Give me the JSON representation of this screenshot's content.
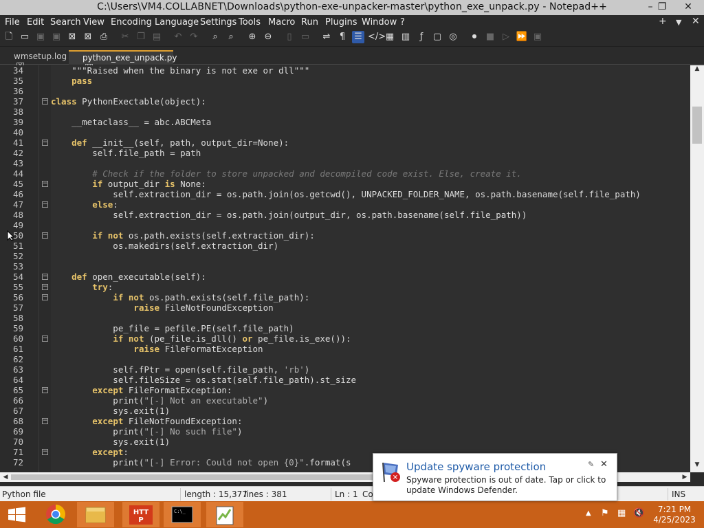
{
  "window": {
    "title": "C:\\Users\\VM4.COLLABNET\\Downloads\\python-exe-unpacker-master\\python_exe_unpack.py - Notepad++",
    "minimize": "–",
    "restore": "❐",
    "close": "✕"
  },
  "menu": {
    "items": [
      "File",
      "Edit",
      "Search",
      "View",
      "Encoding",
      "Language",
      "Settings",
      "Tools",
      "Macro",
      "Run",
      "Plugins",
      "Window",
      "?"
    ],
    "right_plus": "+",
    "right_down": "▼",
    "right_close": "✕"
  },
  "tabs": [
    {
      "label": "wmsetup.log",
      "active": false
    },
    {
      "label": "python_exe_unpack.py",
      "active": true
    }
  ],
  "editor": {
    "line_numbers": [
      "34",
      "35",
      "36",
      "37",
      "38",
      "39",
      "40",
      "41",
      "42",
      "43",
      "44",
      "45",
      "46",
      "47",
      "48",
      "49",
      "50",
      "51",
      "52",
      "53",
      "54",
      "55",
      "56",
      "57",
      "58",
      "59",
      "60",
      "61",
      "62",
      "63",
      "64",
      "65",
      "66",
      "67",
      "68",
      "69",
      "70",
      "71",
      "72"
    ],
    "lines": [
      [
        [
          "",
          "    \"\"\"Raised when the binary is not exe or dll\"\"\""
        ]
      ],
      [
        [
          "",
          "    "
        ],
        [
          "kw",
          "pass"
        ]
      ],
      [
        [
          "",
          ""
        ]
      ],
      [
        [
          "kw",
          "class"
        ],
        [
          "",
          " PythonExectable(object):"
        ]
      ],
      [
        [
          "",
          ""
        ]
      ],
      [
        [
          "",
          "    __metaclass__ = abc.ABCMeta"
        ]
      ],
      [
        [
          "",
          ""
        ]
      ],
      [
        [
          "",
          "    "
        ],
        [
          "kw",
          "def"
        ],
        [
          "",
          " __init__(self, path, output_dir=None):"
        ]
      ],
      [
        [
          "",
          "        self.file_path = path"
        ]
      ],
      [
        [
          "",
          ""
        ]
      ],
      [
        [
          "cm",
          "        # Check if the folder to store unpacked and decompiled code exist. Else, create it."
        ]
      ],
      [
        [
          "",
          "        "
        ],
        [
          "kw",
          "if"
        ],
        [
          "",
          " output_dir "
        ],
        [
          "kw",
          "is"
        ],
        [
          "",
          " None:"
        ]
      ],
      [
        [
          "",
          "            self.extraction_dir = os.path.join(os.getcwd(), UNPACKED_FOLDER_NAME, os.path.basename(self.file_path)"
        ]
      ],
      [
        [
          "",
          "        "
        ],
        [
          "kw",
          "else"
        ],
        [
          "",
          ":"
        ]
      ],
      [
        [
          "",
          "            self.extraction_dir = os.path.join(output_dir, os.path.basename(self.file_path))"
        ]
      ],
      [
        [
          "",
          ""
        ]
      ],
      [
        [
          "",
          "        "
        ],
        [
          "kw",
          "if not"
        ],
        [
          "",
          " os.path.exists(self.extraction_dir):"
        ]
      ],
      [
        [
          "",
          "            os.makedirs(self.extraction_dir)"
        ]
      ],
      [
        [
          "",
          ""
        ]
      ],
      [
        [
          "",
          ""
        ]
      ],
      [
        [
          "",
          "    "
        ],
        [
          "kw",
          "def"
        ],
        [
          "",
          " open_executable(self):"
        ]
      ],
      [
        [
          "",
          "        "
        ],
        [
          "kw",
          "try"
        ],
        [
          "",
          ":"
        ]
      ],
      [
        [
          "",
          "            "
        ],
        [
          "kw",
          "if not"
        ],
        [
          "",
          " os.path.exists(self.file_path):"
        ]
      ],
      [
        [
          "",
          "                "
        ],
        [
          "kw",
          "raise"
        ],
        [
          "",
          " FileNotFoundException"
        ]
      ],
      [
        [
          "",
          ""
        ]
      ],
      [
        [
          "",
          "            pe_file = pefile.PE(self.file_path)"
        ]
      ],
      [
        [
          "",
          "            "
        ],
        [
          "kw",
          "if not"
        ],
        [
          "",
          " (pe_file.is_dll() "
        ],
        [
          "kw",
          "or"
        ],
        [
          "",
          " pe_file.is_exe()):"
        ]
      ],
      [
        [
          "",
          "                "
        ],
        [
          "kw",
          "raise"
        ],
        [
          "",
          " FileFormatException"
        ]
      ],
      [
        [
          "",
          ""
        ]
      ],
      [
        [
          "",
          "            self.fPtr = open(self.file_path, "
        ],
        [
          "st",
          "'rb'"
        ],
        [
          "",
          ")"
        ]
      ],
      [
        [
          "",
          "            self.fileSize = os.stat(self.file_path).st_size"
        ]
      ],
      [
        [
          "",
          "        "
        ],
        [
          "kw",
          "except"
        ],
        [
          "",
          " FileFormatException:"
        ]
      ],
      [
        [
          "",
          "            print("
        ],
        [
          "st",
          "\"[-] Not an executable\""
        ],
        [
          "",
          ")"
        ]
      ],
      [
        [
          "",
          "            sys.exit(1)"
        ]
      ],
      [
        [
          "",
          "        "
        ],
        [
          "kw",
          "except"
        ],
        [
          "",
          " FileNotFoundException:"
        ]
      ],
      [
        [
          "",
          "            print("
        ],
        [
          "st",
          "\"[-] No such file\""
        ],
        [
          "",
          ")"
        ]
      ],
      [
        [
          "",
          "            sys.exit(1)"
        ]
      ],
      [
        [
          "",
          "        "
        ],
        [
          "kw",
          "except"
        ],
        [
          "",
          ":"
        ]
      ],
      [
        [
          "",
          "            print("
        ],
        [
          "st",
          "\"[-] Error: Could not open {0}\""
        ],
        [
          "",
          ".format(s"
        ]
      ]
    ],
    "fold_lines": [
      "37",
      "41",
      "45",
      "47",
      "50",
      "54",
      "55",
      "56",
      "60",
      "65",
      "68",
      "71"
    ]
  },
  "statusbar": {
    "filetype": "Python file",
    "length": "length : 15,377",
    "lines": "lines : 381",
    "position": "Ln : 1",
    "col_partial": "Co",
    "mode": "INS"
  },
  "taskbar": {
    "time": "7:21 PM",
    "date": "4/25/2023"
  },
  "notification": {
    "title": "Update spyware protection",
    "body": "Spyware protection is out of date. Tap or click to update Windows Defender.",
    "close": "✕",
    "pin": "✎"
  },
  "colors": {
    "accent": "#e0a030",
    "taskbar": "#c86018",
    "keyword": "#e8c46a",
    "notification_title": "#1f5ba8"
  }
}
